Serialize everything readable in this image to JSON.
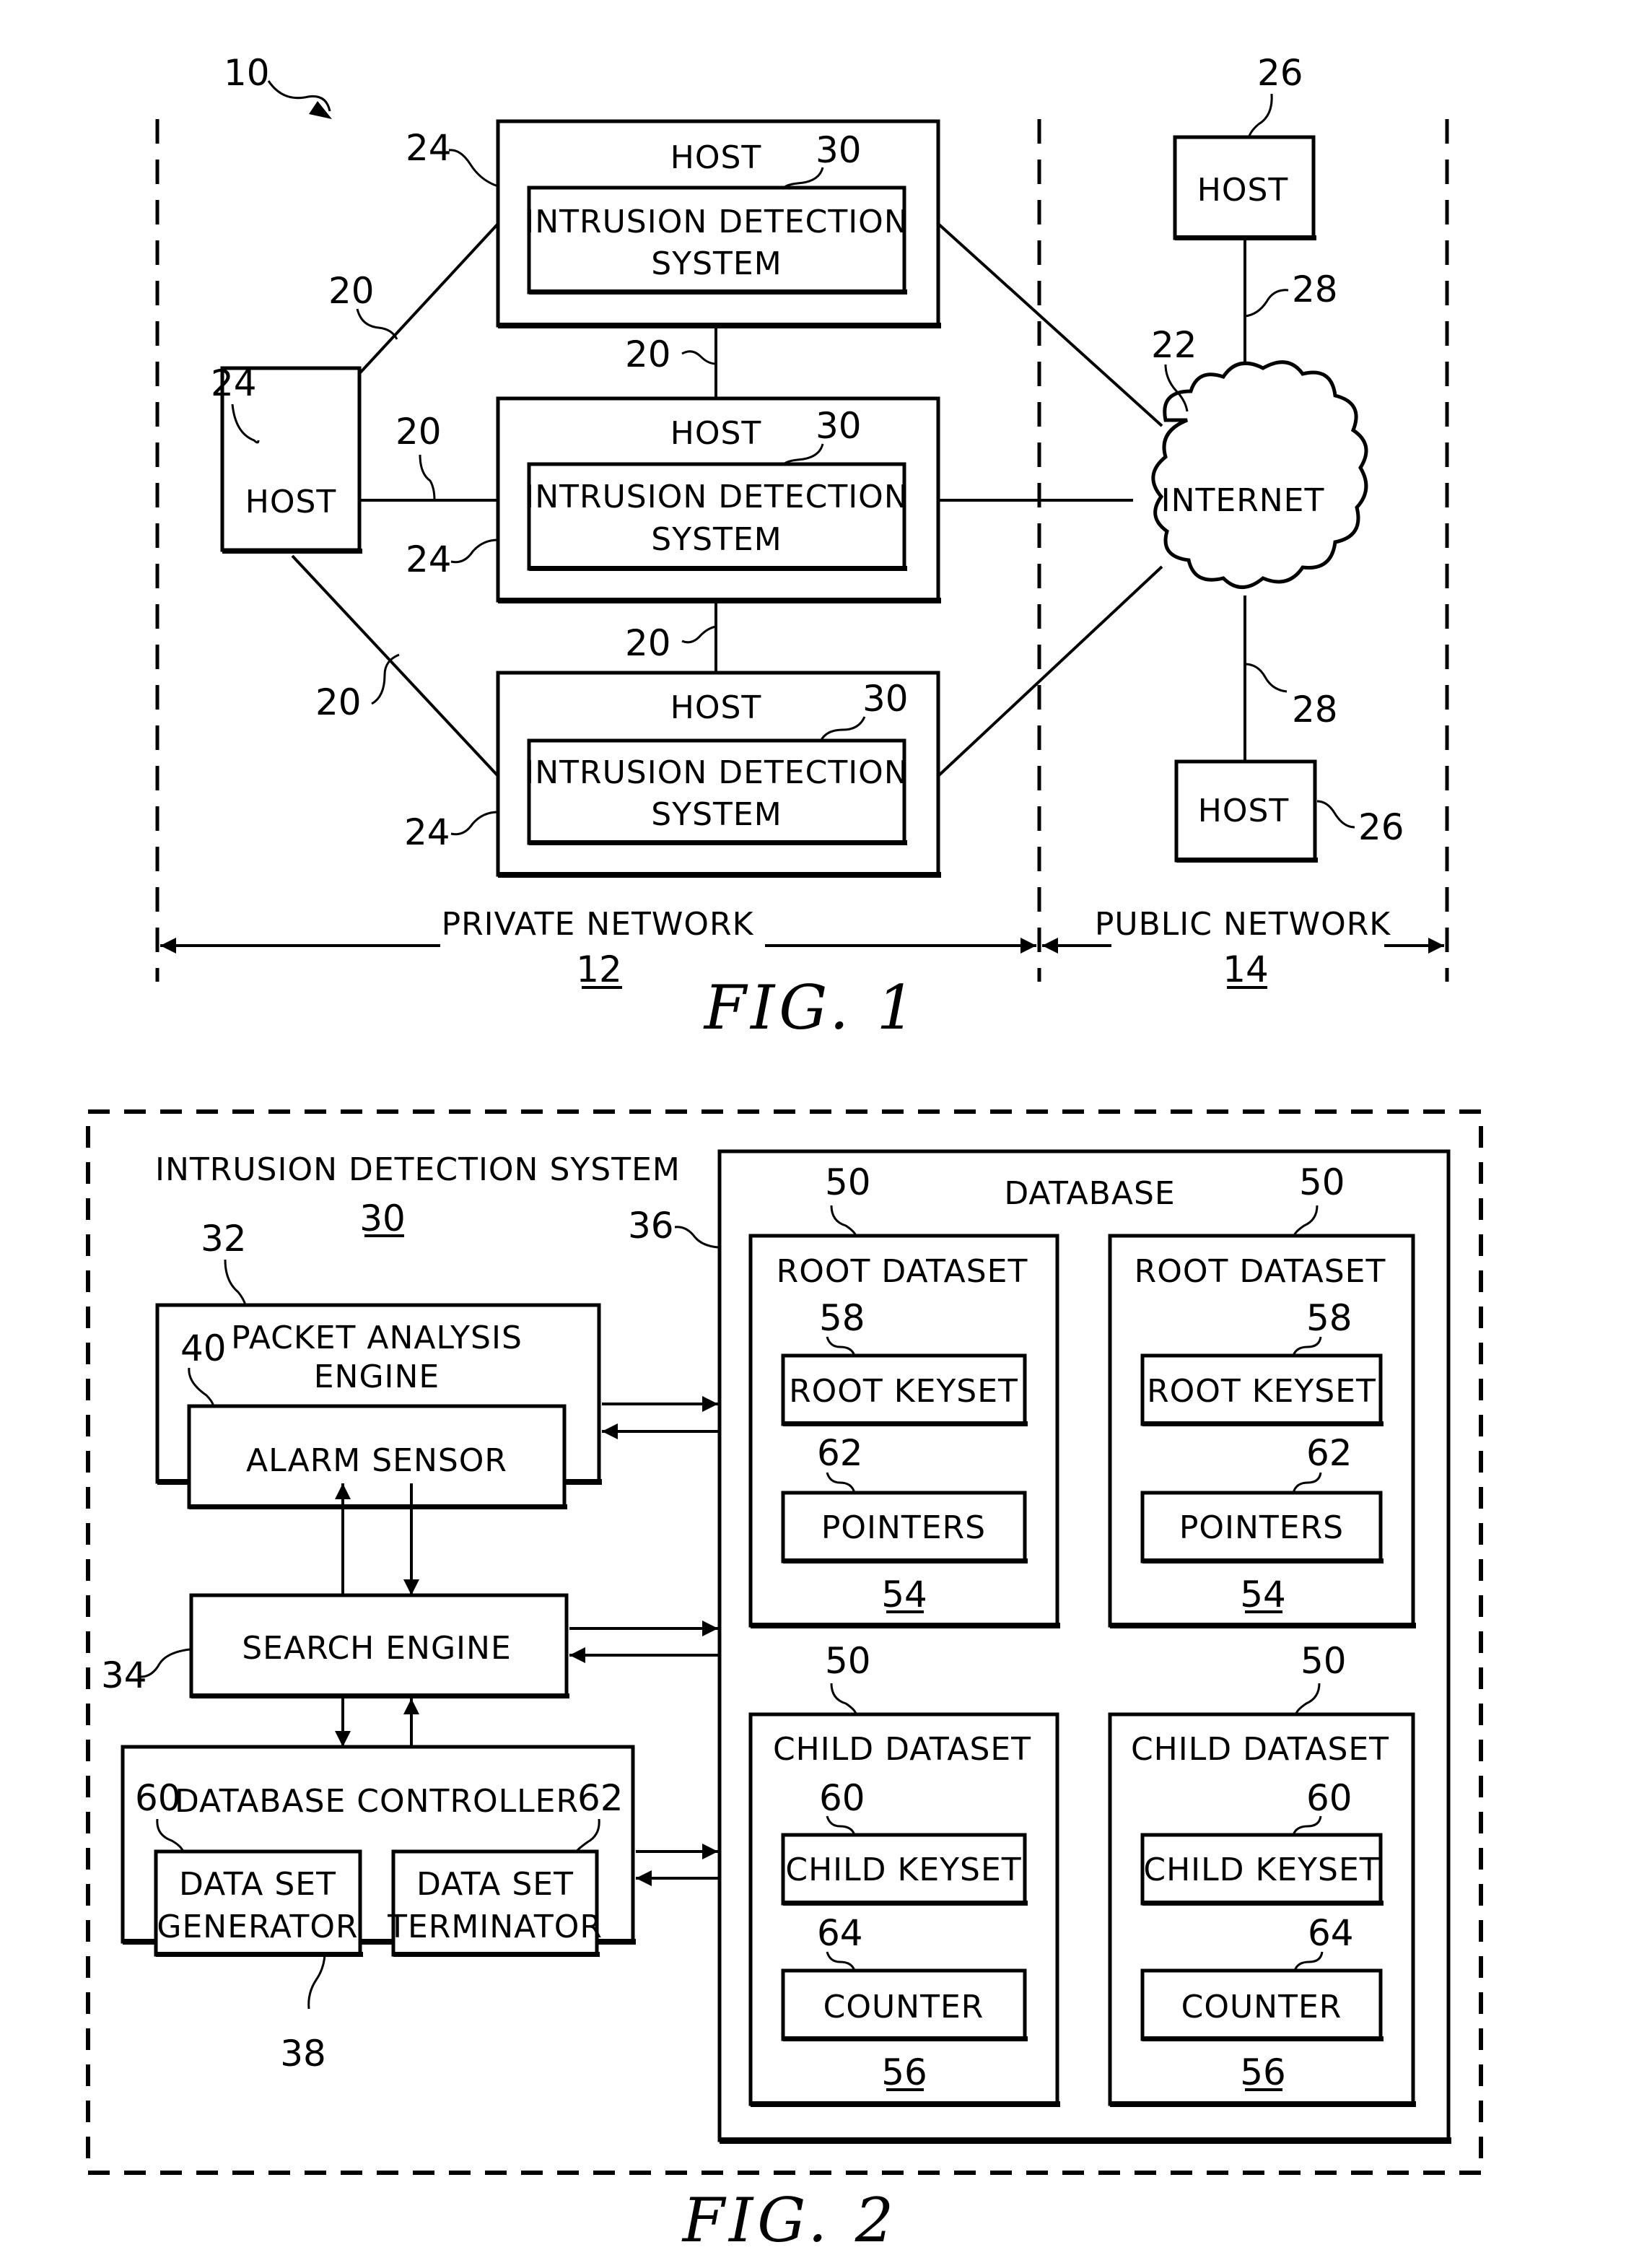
{
  "fig1": {
    "caption": "FIG.  1",
    "system_ref": "10",
    "hosts_private": [
      {
        "label": "HOST",
        "ref": "24",
        "ids_line1": "INTRUSION  DETECTION",
        "ids_line2": "SYSTEM",
        "ids_ref": "30"
      },
      {
        "label": "HOST",
        "ref": "24",
        "ids_line1": "INTRUSION  DETECTION",
        "ids_line2": "SYSTEM",
        "ids_ref": "30"
      },
      {
        "label": "HOST",
        "ref": "24",
        "ids_line1": "INTRUSION  DETECTION",
        "ids_line2": "SYSTEM",
        "ids_ref": "30"
      }
    ],
    "left_host": {
      "label": "HOST",
      "ref": "24"
    },
    "link_ref": "20",
    "internet": {
      "label": "INTERNET",
      "ref": "22"
    },
    "public_hosts": [
      {
        "label": "HOST",
        "ref": "26",
        "link_ref": "28"
      },
      {
        "label": "HOST",
        "ref": "26",
        "link_ref": "28"
      }
    ],
    "private_network": {
      "label": "PRIVATE  NETWORK",
      "ref": "12"
    },
    "public_network": {
      "label": "PUBLIC  NETWORK",
      "ref": "14"
    }
  },
  "fig2": {
    "caption": "FIG.  2",
    "ids": {
      "label": "INTRUSION  DETECTION  SYSTEM",
      "ref": "30"
    },
    "packet_engine": {
      "line1": "PACKET  ANALYSIS",
      "line2": "ENGINE",
      "ref": "32"
    },
    "alarm_sensor": {
      "label": "ALARM  SENSOR",
      "ref": "40"
    },
    "search_engine": {
      "label": "SEARCH  ENGINE",
      "ref": "34"
    },
    "db_controller": {
      "label": "DATABASE  CONTROLLER",
      "ref": "38"
    },
    "generator": {
      "line1": "DATA  SET",
      "line2": "GENERATOR",
      "ref": "60"
    },
    "terminator": {
      "line1": "DATA  SET",
      "line2": "TERMINATOR",
      "ref": "62"
    },
    "database": {
      "label": "DATABASE",
      "ref": "36"
    },
    "root_datasets": [
      {
        "label": "ROOT  DATASET",
        "ref": "50",
        "keyset": "ROOT  KEYSET",
        "keyset_ref": "58",
        "inner": "POINTERS",
        "inner_ref": "62",
        "id": "54"
      },
      {
        "label": "ROOT  DATASET",
        "ref": "50",
        "keyset": "ROOT  KEYSET",
        "keyset_ref": "58",
        "inner": "POINTERS",
        "inner_ref": "62",
        "id": "54"
      }
    ],
    "child_datasets": [
      {
        "label": "CHILD  DATASET",
        "ref": "50",
        "keyset": "CHILD  KEYSET",
        "keyset_ref": "60",
        "inner": "COUNTER",
        "inner_ref": "64",
        "id": "56"
      },
      {
        "label": "CHILD  DATASET",
        "ref": "50",
        "keyset": "CHILD  KEYSET",
        "keyset_ref": "60",
        "inner": "COUNTER",
        "inner_ref": "64",
        "id": "56"
      }
    ]
  }
}
